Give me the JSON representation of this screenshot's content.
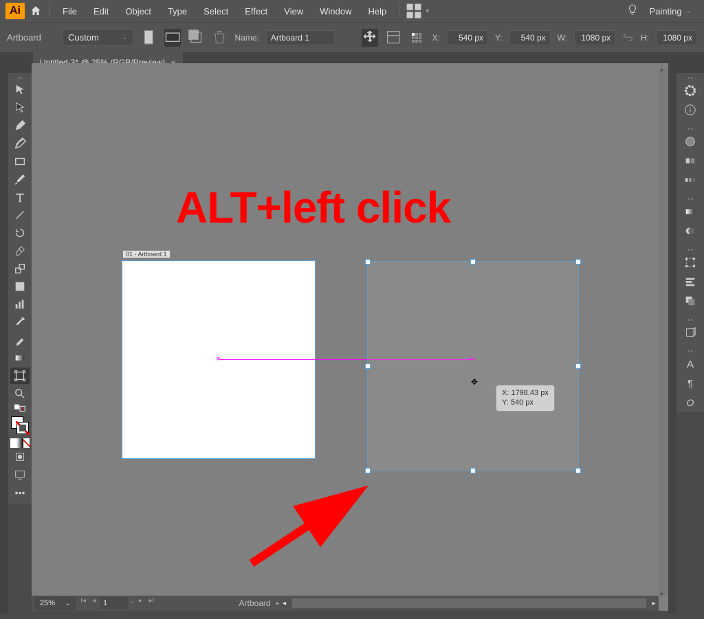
{
  "menubar": {
    "items": [
      "File",
      "Edit",
      "Object",
      "Type",
      "Select",
      "Effect",
      "View",
      "Window",
      "Help"
    ],
    "workspace": "Painting"
  },
  "controlbar": {
    "context_label": "Artboard",
    "preset": "Custom",
    "name_label": "Name:",
    "name_value": "Artboard 1",
    "x_label": "X:",
    "x_value": "540 px",
    "y_label": "Y:",
    "y_value": "540 px",
    "w_label": "W:",
    "w_value": "1080 px",
    "h_label": "H:",
    "h_value": "1080 px"
  },
  "tab": {
    "title": "Untitled-3* @ 25% (RGB/Preview)"
  },
  "canvas": {
    "artboard1_label": "01 - Artboard 1",
    "tooltip_x": "X: 1798,43 px",
    "tooltip_y": "Y: 540 px",
    "overlay_text": "ALT+left click"
  },
  "statusbar": {
    "zoom": "25%",
    "page": "1",
    "context": "Artboard"
  }
}
